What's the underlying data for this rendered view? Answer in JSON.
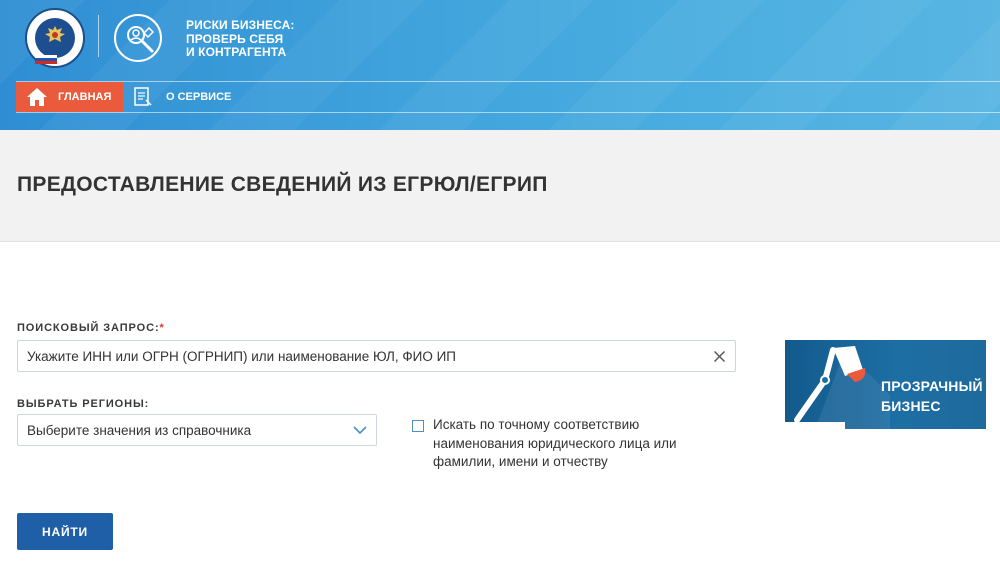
{
  "header": {
    "brand_line1": "РИСКИ БИЗНЕСА:",
    "brand_line2": "ПРОВЕРЬ СЕБЯ",
    "brand_line3": "И КОНТРАГЕНТА",
    "logo_icon": "fns-emblem-icon",
    "service_icon": "magnifier-wrench-icon"
  },
  "nav": {
    "home_label": "ГЛАВНАЯ",
    "about_label": "О СЕРВИСЕ",
    "home_color": "#ea5a3c"
  },
  "page": {
    "title": "ПРЕДОСТАВЛЕНИЕ СВЕДЕНИЙ ИЗ ЕГРЮЛ/ЕГРИП"
  },
  "form": {
    "search_label": "ПОИСКОВЫЙ ЗАПРОС:",
    "required_mark": "*",
    "search_placeholder": "Укажите ИНН или ОГРН (ОГРНИП) или наименование ЮЛ, ФИО ИП",
    "region_label": "ВЫБРАТЬ РЕГИОНЫ:",
    "region_placeholder": "Выберите значения из справочника",
    "exact_match_label": "Искать по точному соответствию наименования юридического лица или фамилии, имени и отчеству",
    "exact_match_checked": false,
    "submit_label": "НАЙТИ",
    "submit_color": "#1f5fa8"
  },
  "banner": {
    "line1": "ПРОЗРАЧНЫЙ",
    "line2": "БИЗНЕС"
  }
}
